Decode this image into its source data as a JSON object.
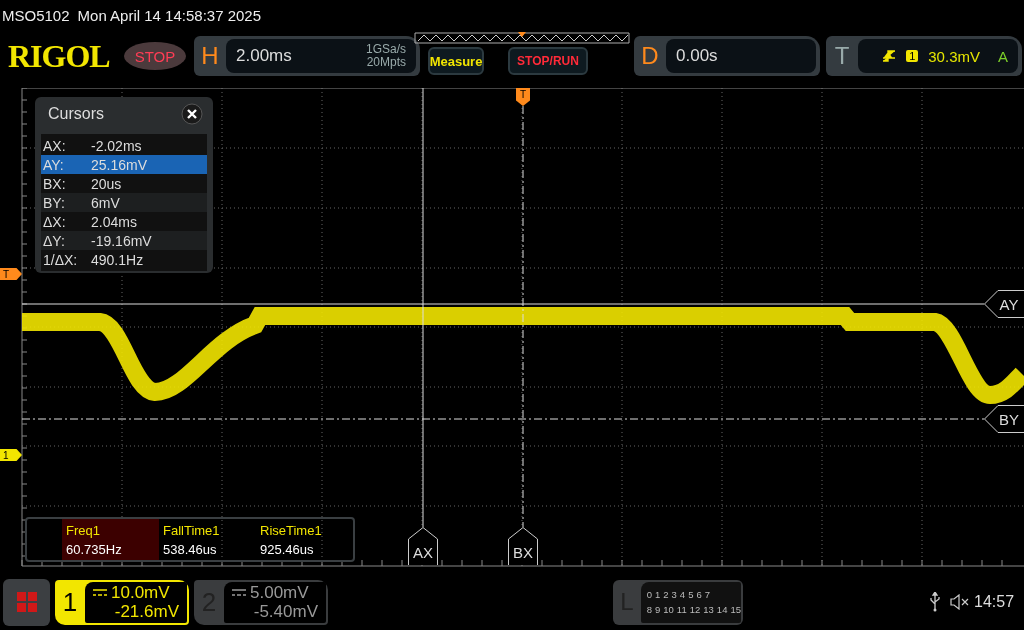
{
  "status_bar": {
    "model": "MSO5102",
    "datetime": "Mon April 14 14:58:37 2025"
  },
  "toolbar": {
    "logo": "RIGOL",
    "run_state": "STOP",
    "horizontal": {
      "label": "H",
      "timebase": "2.00ms",
      "sample_rate": "1GSa/s",
      "memory_depth": "20Mpts"
    },
    "buttons": [
      "Measure",
      "STOP/RUN"
    ],
    "delay": {
      "label": "D",
      "value": "0.00s"
    },
    "trigger": {
      "label": "T",
      "source": "1",
      "level": "30.3mV",
      "mode": "A"
    }
  },
  "waveform": {
    "trigger_position": "T",
    "trigger_level_marker": "T",
    "channel_marker": "1",
    "cursor_labels": {
      "ax": "AX",
      "bx": "BX",
      "ay": "AY",
      "by": "BY"
    }
  },
  "cursors_panel": {
    "title": "Cursors",
    "rows": [
      {
        "label": "AX:",
        "value": "-2.02ms",
        "selected": false
      },
      {
        "label": "AY:",
        "value": "25.16mV",
        "selected": true
      },
      {
        "label": "BX:",
        "value": "20us",
        "selected": false
      },
      {
        "label": "BY:",
        "value": "6mV",
        "selected": false
      },
      {
        "label": "ΔX:",
        "value": "2.04ms",
        "selected": false
      },
      {
        "label": "ΔY:",
        "value": "-19.16mV",
        "selected": false
      },
      {
        "label": "1/ΔX:",
        "value": "490.1Hz",
        "selected": false
      }
    ]
  },
  "measurements": [
    {
      "name": "Freq1",
      "value": "60.735Hz",
      "selected": true
    },
    {
      "name": "FallTime1",
      "value": "538.46us",
      "selected": false
    },
    {
      "name": "RiseTime1",
      "value": "925.46us",
      "selected": false
    }
  ],
  "channels": [
    {
      "number": "1",
      "scale": "10.0mV",
      "offset": "-21.6mV",
      "selected": true
    },
    {
      "number": "2",
      "scale": "5.00mV",
      "offset": "-5.40mV",
      "selected": false
    }
  ],
  "logic": {
    "label": "L",
    "row_1": [
      "0",
      "1",
      "2",
      "3",
      "4",
      "5",
      "6",
      "7"
    ],
    "row_2": [
      "8",
      "9",
      "10",
      "11",
      "12",
      "13",
      "14",
      "15"
    ]
  },
  "clock": "14:57"
}
